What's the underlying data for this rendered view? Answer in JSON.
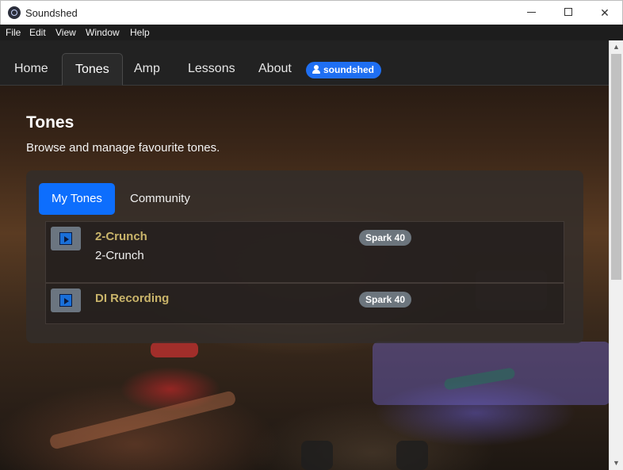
{
  "window": {
    "title": "Soundshed",
    "controls": {
      "minimize": "minimize-icon",
      "maximize": "maximize-icon",
      "close": "✕"
    }
  },
  "menubar": {
    "items": [
      "File",
      "Edit",
      "View",
      "Window",
      "Help"
    ]
  },
  "nav": {
    "tabs": [
      "Home",
      "Tones",
      "Amp",
      "Lessons",
      "About"
    ],
    "active_tab": "Tones",
    "user": "soundshed"
  },
  "page": {
    "title": "Tones",
    "subtitle": "Browse and manage favourite tones."
  },
  "subtabs": {
    "items": [
      "My Tones",
      "Community"
    ],
    "active": "My Tones"
  },
  "tones": [
    {
      "name": "2-Crunch",
      "description": "2-Crunch",
      "device": "Spark 40"
    },
    {
      "name": "DI Recording",
      "description": "",
      "device": "Spark 40"
    }
  ],
  "scrollbar": {
    "up": "▲",
    "down": "▼"
  },
  "colors": {
    "accent": "#0d6efd",
    "user_badge": "#1f6ff2",
    "tone_name": "#c9b46a",
    "device_badge": "#6c757d"
  }
}
